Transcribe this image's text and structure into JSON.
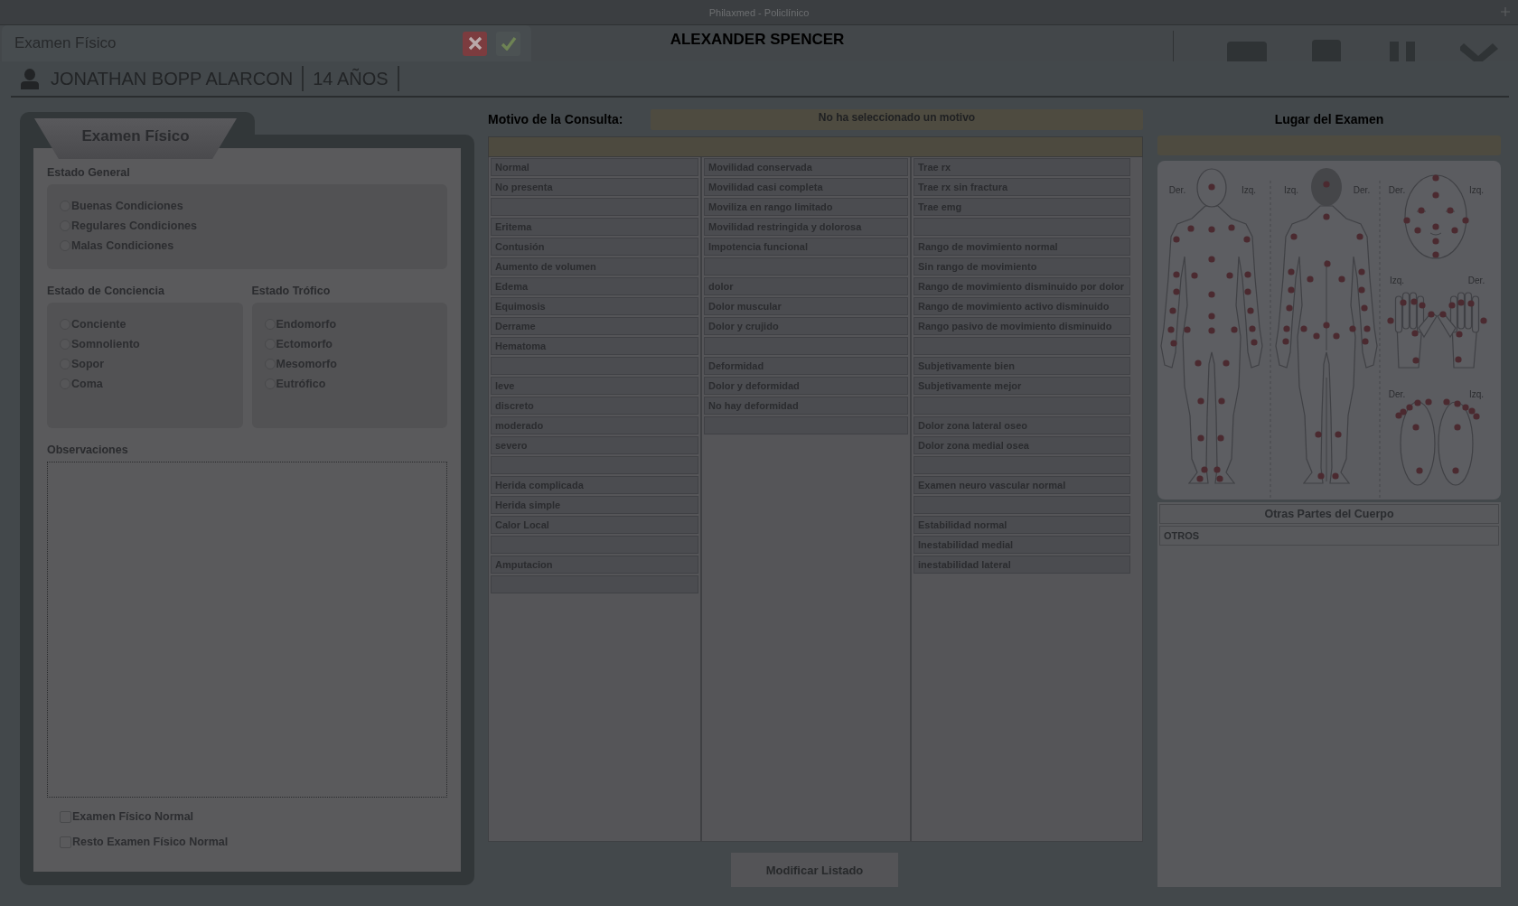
{
  "app": {
    "title": "Philaxmed - Policlínico"
  },
  "background": {
    "patient_name": "ALEXANDER SPENCER"
  },
  "dialog": {
    "title": "Examen Físico",
    "buttons": [
      {
        "kind": "cancel"
      },
      {
        "kind": "confirm"
      }
    ]
  },
  "patient": {
    "name": "JONATHAN BOPP ALARCON",
    "age": "14 AÑOS"
  },
  "exam_form": {
    "tab": "Examen Físico",
    "groups": [
      {
        "title": "Estado General",
        "options": [
          {
            "label": "Buenas Condiciones",
            "selected": false
          },
          {
            "label": "Regulares Condiciones",
            "selected": false
          },
          {
            "label": "Malas Condiciones",
            "selected": false
          }
        ]
      },
      {
        "title": "Estado de Conciencia",
        "options": [
          {
            "label": "Conciente",
            "selected": false
          },
          {
            "label": "Somnoliento",
            "selected": false
          },
          {
            "label": "Sopor",
            "selected": false
          },
          {
            "label": "Coma",
            "selected": false
          }
        ]
      },
      {
        "title": "Estado Trófico",
        "options": [
          {
            "label": "Endomorfo",
            "selected": false
          },
          {
            "label": "Ectomorfo",
            "selected": false
          },
          {
            "label": "Mesomorfo",
            "selected": false
          },
          {
            "label": "Eutrófico",
            "selected": false
          }
        ]
      }
    ],
    "observations": {
      "label": "Observaciones"
    },
    "checkboxes": [
      {
        "label": "Examen Físico Normal",
        "checked": false
      },
      {
        "label": "Resto Examen Físico Normal",
        "checked": false
      }
    ]
  },
  "consultation": {
    "label": "Motivo de la Consulta:",
    "reason": "No ha seleccionado un motivo",
    "columns": [
      {
        "items": [
          {
            "kind": "item",
            "label": "Normal"
          },
          {
            "kind": "item",
            "label": "No presenta"
          },
          {
            "kind": "blank"
          },
          {
            "kind": "item",
            "label": "Eritema"
          },
          {
            "kind": "item",
            "label": "Contusión"
          },
          {
            "kind": "item",
            "label": "Aumento de volumen"
          },
          {
            "kind": "item",
            "label": "Edema"
          },
          {
            "kind": "item",
            "label": "Equimosis"
          },
          {
            "kind": "item",
            "label": "Derrame"
          },
          {
            "kind": "item",
            "label": "Hematoma"
          },
          {
            "kind": "blank"
          },
          {
            "kind": "item",
            "label": "leve"
          },
          {
            "kind": "item",
            "label": "discreto"
          },
          {
            "kind": "item",
            "label": "moderado"
          },
          {
            "kind": "item",
            "label": "severo"
          },
          {
            "kind": "blank"
          },
          {
            "kind": "item",
            "label": "Herida complicada"
          },
          {
            "kind": "item",
            "label": "Herida simple"
          },
          {
            "kind": "item",
            "label": "Calor Local"
          },
          {
            "kind": "blank"
          },
          {
            "kind": "item",
            "label": "Amputacion"
          },
          {
            "kind": "blank"
          }
        ]
      },
      {
        "items": [
          {
            "kind": "item",
            "label": "Movilidad conservada"
          },
          {
            "kind": "item",
            "label": "Movilidad casi completa"
          },
          {
            "kind": "item",
            "label": "Moviliza en rango limitado"
          },
          {
            "kind": "item",
            "label": "Movilidad restringida y dolorosa"
          },
          {
            "kind": "item",
            "label": "Impotencia funcional"
          },
          {
            "kind": "blank"
          },
          {
            "kind": "item",
            "label": "dolor"
          },
          {
            "kind": "item",
            "label": "Dolor muscular"
          },
          {
            "kind": "item",
            "label": "Dolor y crujido"
          },
          {
            "kind": "blank"
          },
          {
            "kind": "item",
            "label": "Deformidad"
          },
          {
            "kind": "item",
            "label": "Dolor y deformidad"
          },
          {
            "kind": "item",
            "label": "No hay deformidad"
          },
          {
            "kind": "blank"
          }
        ]
      },
      {
        "items": [
          {
            "kind": "item",
            "label": "Trae rx"
          },
          {
            "kind": "item",
            "label": "Trae rx sin fractura"
          },
          {
            "kind": "item",
            "label": "Trae emg"
          },
          {
            "kind": "blank"
          },
          {
            "kind": "item",
            "label": "Rango de movimiento normal"
          },
          {
            "kind": "item",
            "label": "Sin rango de movimiento"
          },
          {
            "kind": "item",
            "label": "Rango de movimiento disminuido por dolor"
          },
          {
            "kind": "item",
            "label": "Rango de movimiento activo disminuido"
          },
          {
            "kind": "item",
            "label": "Rango pasivo de movimiento disminuido"
          },
          {
            "kind": "blank"
          },
          {
            "kind": "item",
            "label": "Subjetivamente bien"
          },
          {
            "kind": "item",
            "label": "Subjetivamente mejor"
          },
          {
            "kind": "blank"
          },
          {
            "kind": "item",
            "label": "Dolor zona lateral oseo"
          },
          {
            "kind": "item",
            "label": "Dolor zona medial osea"
          },
          {
            "kind": "blank"
          },
          {
            "kind": "item",
            "label": "Examen neuro vascular normal"
          },
          {
            "kind": "blank"
          },
          {
            "kind": "item",
            "label": "Estabilidad normal"
          },
          {
            "kind": "item",
            "label": "Inestabilidad medial"
          },
          {
            "kind": "item",
            "label": "inestabilidad lateral"
          }
        ]
      }
    ],
    "button": "Modificar Listado"
  },
  "exam_site": {
    "title": "Lugar del Examen",
    "figures": [
      {
        "kind": "front",
        "labels": [
          "Der.",
          "Izq."
        ]
      },
      {
        "kind": "back",
        "labels": [
          "Izq.",
          "Der."
        ]
      },
      {
        "kind": "face",
        "labels": [
          "Der.",
          "Izq."
        ]
      },
      {
        "kind": "hands",
        "labels": [
          "Izq.",
          "Der."
        ]
      },
      {
        "kind": "feet",
        "labels": [
          "Der.",
          "Izq."
        ]
      }
    ],
    "other_parts": {
      "title": "Otras Partes del Cuerpo",
      "items": [
        "OTROS"
      ]
    }
  }
}
